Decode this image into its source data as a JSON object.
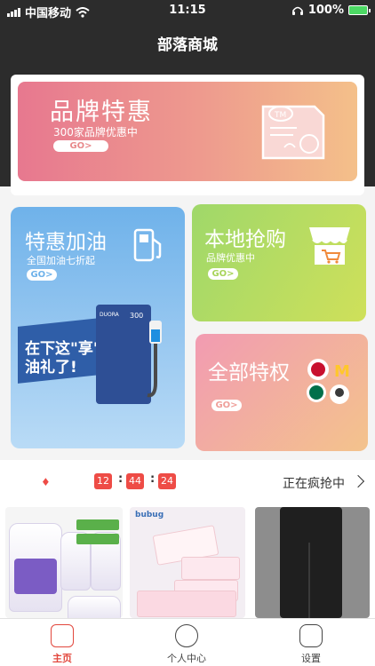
{
  "status_bar": {
    "carrier": "中国移动",
    "time": "11:15",
    "battery": "100%"
  },
  "header": {
    "title": "部落商城"
  },
  "banner": {
    "title": "品牌特惠",
    "subtitle": "300家品牌优惠中",
    "go": "GO>",
    "doc_mark": "TM"
  },
  "cards": {
    "fuel": {
      "title": "特惠加油",
      "subtitle": "全国加油七折起",
      "go": "GO>",
      "slogan_line1": "在下这\"享\"",
      "slogan_line2": "油礼了!",
      "pump_number": "300",
      "pump_brand": "DUORA"
    },
    "local": {
      "title": "本地抢购",
      "subtitle": "品牌优惠中",
      "go": "GO>"
    },
    "all": {
      "title": "全部特权",
      "go": "GO>"
    }
  },
  "flash_sale": {
    "hours": "12",
    "minutes": "44",
    "seconds": "24",
    "separator": ":",
    "status": "正在疯抢中"
  },
  "products": {
    "item2_brand": "bubug"
  },
  "tabbar": {
    "home": "主页",
    "user": "个人中心",
    "settings": "设置"
  },
  "colors": {
    "accent_red": "#ee4c46",
    "header_bg": "#2c2c2c",
    "fuel_blue": "#6fb2ea",
    "local_green": "#a8d45a"
  },
  "icons": [
    "signal-icon",
    "wifi-icon",
    "headphones-icon",
    "battery-icon",
    "fuel-pump-icon",
    "shop-cart-icon",
    "brand-logos-icon",
    "flame-icon",
    "chevron-right-icon",
    "home-icon",
    "user-star-icon",
    "settings-icon"
  ]
}
